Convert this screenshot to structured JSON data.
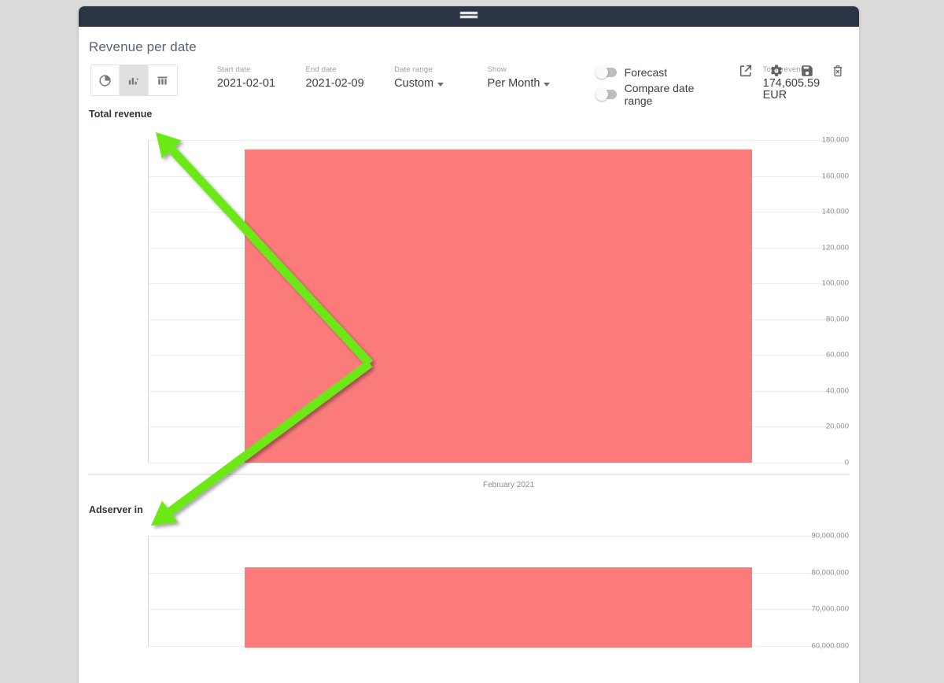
{
  "window": {
    "drag_handle_icon": "drag-handle-icon"
  },
  "header": {
    "title": "Revenue per date",
    "icons": [
      {
        "name": "open-external-icon",
        "label": "Open in new window"
      },
      {
        "name": "gear-icon",
        "label": "Settings"
      },
      {
        "name": "save-icon",
        "label": "Save"
      },
      {
        "name": "delete-icon",
        "label": "Delete"
      }
    ]
  },
  "toolbar": {
    "chart_types": [
      {
        "name": "pie-chart-button",
        "label": "Pie chart",
        "active": false
      },
      {
        "name": "bar-chart-button",
        "label": "Bar chart",
        "active": true
      },
      {
        "name": "table-view-button",
        "label": "Table",
        "active": false
      }
    ],
    "start_date": {
      "label": "Start date",
      "value": "2021-02-01"
    },
    "end_date": {
      "label": "End date",
      "value": "2021-02-09"
    },
    "date_range": {
      "label": "Date range",
      "value": "Custom"
    },
    "show": {
      "label": "Show",
      "value": "Per Month"
    },
    "forecast_toggle": {
      "label": "Forecast",
      "on": false
    },
    "compare_toggle": {
      "label": "Compare date range",
      "on": false
    },
    "total_revenue": {
      "label": "Total revenue",
      "value": "174,605.59 EUR"
    }
  },
  "colors": {
    "bar": "#fb7b7b",
    "titlebar": "#2b3445",
    "page_background": "#dcdcdc",
    "annotation": "#6ce817",
    "gridline": "#ededed"
  },
  "chart_data": [
    {
      "type": "bar",
      "title": "Total revenue",
      "categories": [
        "February 2021"
      ],
      "values": [
        174605.59
      ],
      "xlabel": "",
      "ylabel": "",
      "ylim": [
        0,
        180000
      ],
      "yticks": [
        180000,
        160000,
        140000,
        120000,
        100000,
        80000,
        60000,
        40000,
        20000,
        0
      ],
      "ytick_labels": [
        "180,000",
        "160,000",
        "140,000",
        "120,000",
        "100,000",
        "80,000",
        "60,000",
        "40,000",
        "20,000",
        "0"
      ],
      "grid": true,
      "legend": false
    },
    {
      "type": "bar",
      "title": "Adserver in",
      "categories": [
        "February 2021"
      ],
      "values": [
        81500000
      ],
      "xlabel": "",
      "ylabel": "",
      "ylim": [
        60000000,
        90000000
      ],
      "yticks": [
        90000000,
        80000000,
        70000000,
        60000000
      ],
      "ytick_labels": [
        "90,000,000",
        "80,000,000",
        "70,000,000",
        "60,000,000"
      ],
      "grid": true,
      "legend": false
    }
  ],
  "annotation": {
    "name": "green-double-arrow",
    "shape": "v-shaped double headed arrow",
    "color": "#6ce817"
  }
}
